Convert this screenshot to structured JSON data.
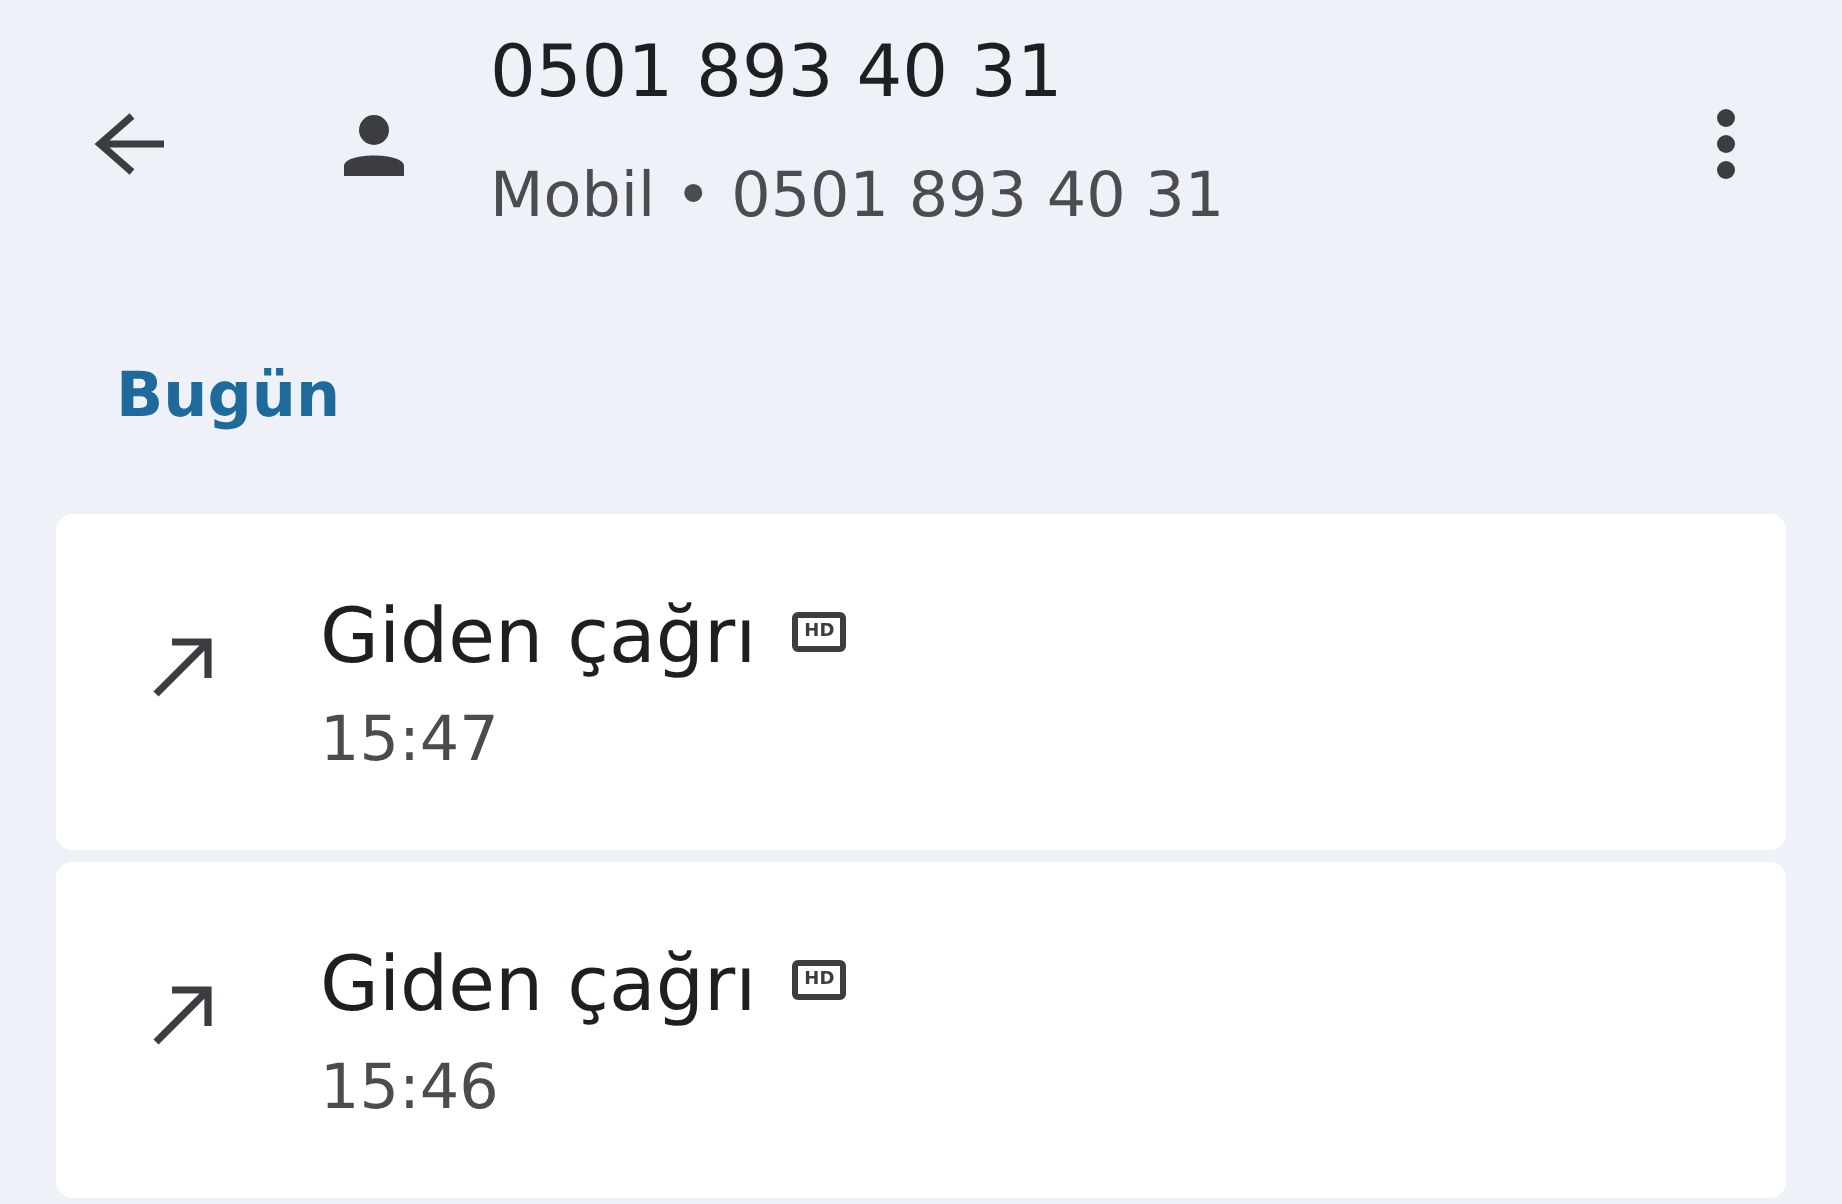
{
  "header": {
    "title": "0501 893 40 31",
    "subtitle": "Mobil • 0501 893 40 31"
  },
  "section": "Bugün",
  "calls": [
    {
      "kind": "outgoing",
      "label": "Giden çağrı",
      "badge": "HD",
      "time": "15:47"
    },
    {
      "kind": "outgoing",
      "label": "Giden çağrı",
      "badge": "HD",
      "time": "15:46"
    }
  ]
}
